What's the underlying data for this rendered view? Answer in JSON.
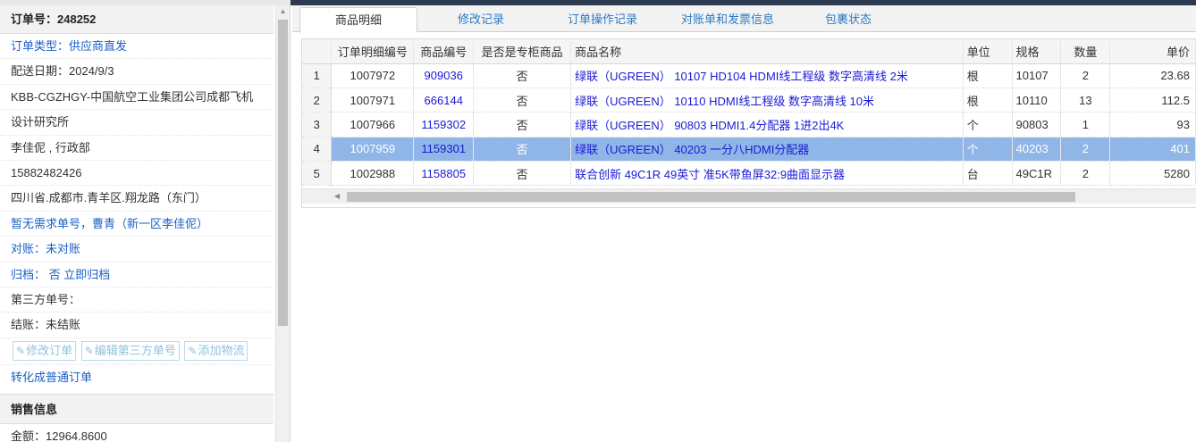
{
  "order": {
    "number_label": "订单号：248252",
    "info_rows": [
      {
        "text": "订单类型：供应商直发",
        "style": "blue"
      },
      {
        "text": "配送日期：2024/9/3",
        "style": "dark"
      },
      {
        "text": "KBB-CGZHGY-中国航空工业集团公司成都飞机",
        "style": "dark"
      },
      {
        "text": "设计研究所",
        "style": "dark"
      },
      {
        "text": "李佳伲 , 行政部",
        "style": "dark"
      },
      {
        "text": "15882482426",
        "style": "dark"
      },
      {
        "text": "四川省.成都市.青羊区.翔龙路（东门）",
        "style": "dark"
      },
      {
        "text": "暂无需求单号，曹青（新一区李佳伲）",
        "style": "blue"
      },
      {
        "text": "对账：未对账",
        "style": "blue"
      },
      {
        "text": "归档： 否 立即归档",
        "style": "blue"
      },
      {
        "text": "第三方单号：",
        "style": "dark"
      },
      {
        "text": "结账：未结账",
        "style": "dark"
      }
    ],
    "buttons": {
      "edit_order": "修改订单",
      "edit_third_party": "编辑第三方单号",
      "add_logistics": "添加物流"
    },
    "convert_label": "转化成普通订单",
    "sales_section": "销售信息",
    "amount": "金额：12964.8600"
  },
  "tabs": [
    {
      "label": "商品明细",
      "active": true
    },
    {
      "label": "修改记录",
      "active": false
    },
    {
      "label": "订单操作记录",
      "active": false
    },
    {
      "label": "对账单和发票信息",
      "active": false
    },
    {
      "label": "包裹状态",
      "active": false
    }
  ],
  "table": {
    "headers": [
      "订单明细编号",
      "商品编号",
      "是否是专柜商品",
      "商品名称",
      "单位",
      "规格",
      "数量",
      "单价"
    ],
    "rows": [
      {
        "rownum": "1",
        "detail_id": "1007972",
        "product_id": "909036",
        "counter": "否",
        "name": "绿联（UGREEN） 10107 HD104 HDMI线工程级 数字高清线 2米",
        "unit": "根",
        "spec": "10107",
        "qty": "2",
        "price": "23.68",
        "selected": false
      },
      {
        "rownum": "2",
        "detail_id": "1007971",
        "product_id": "666144",
        "counter": "否",
        "name": "绿联（UGREEN） 10110 HDMI线工程级 数字高清线 10米",
        "unit": "根",
        "spec": "10110",
        "qty": "13",
        "price": "112.5",
        "selected": false
      },
      {
        "rownum": "3",
        "detail_id": "1007966",
        "product_id": "1159302",
        "counter": "否",
        "name": "绿联（UGREEN） 90803 HDMI1.4分配器 1进2出4K",
        "unit": "个",
        "spec": "90803",
        "qty": "1",
        "price": "93",
        "selected": false
      },
      {
        "rownum": "4",
        "detail_id": "1007959",
        "product_id": "1159301",
        "counter": "否",
        "name": "绿联（UGREEN） 40203 一分八HDMI分配器",
        "unit": "个",
        "spec": "40203",
        "qty": "2",
        "price": "401",
        "selected": true
      },
      {
        "rownum": "5",
        "detail_id": "1002988",
        "product_id": "1158805",
        "counter": "否",
        "name": "联合创新 49C1R 49英寸 准5K带鱼屏32:9曲面显示器",
        "unit": "台",
        "spec": "49C1R",
        "qty": "2",
        "price": "5280",
        "selected": false
      }
    ]
  },
  "colors": {
    "link_blue": "#1a5fc9",
    "selected_row": "#8fb6e6",
    "tab_blue": "#2a7ac4"
  }
}
